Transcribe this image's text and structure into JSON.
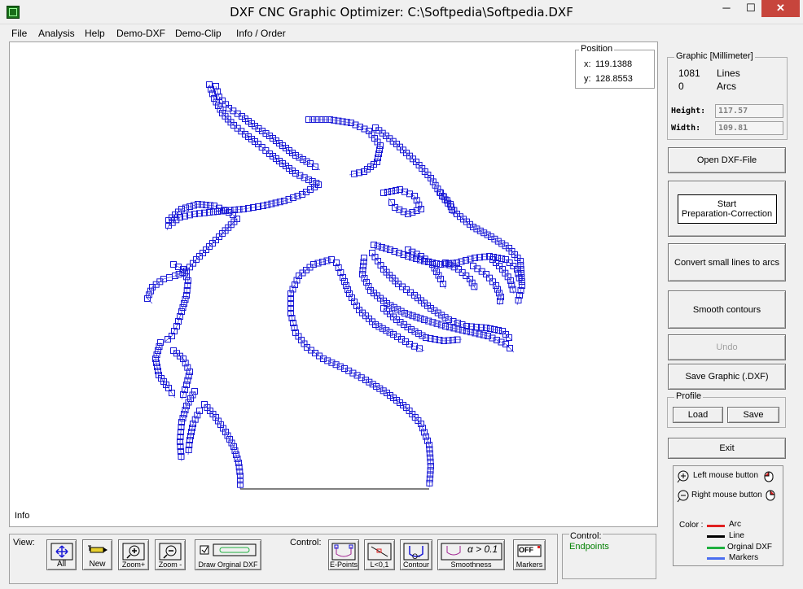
{
  "window": {
    "title": "DXF CNC Graphic Optimizer: C:\\Softpedia\\Softpedia.DXF",
    "min": "─",
    "max": "☐",
    "close": "✕"
  },
  "menu": [
    "File",
    "Analysis",
    "Help",
    "Demo-DXF",
    "Demo-Clip",
    "Info / Order"
  ],
  "position": {
    "title": "Position",
    "x_label": "x:",
    "x_value": "119.1388",
    "y_label": "y:",
    "y_value": "128.8553"
  },
  "info_label": "Info",
  "view": {
    "label": "View:",
    "buttons": [
      {
        "id": "all",
        "caption": "All"
      },
      {
        "id": "new",
        "caption": "New"
      },
      {
        "id": "zoom-in",
        "caption": "Zoom+"
      },
      {
        "id": "zoom-out",
        "caption": "Zoom -"
      },
      {
        "id": "draw-original",
        "caption": "Draw Orginal DXF"
      }
    ]
  },
  "control": {
    "label": "Control:",
    "buttons": [
      {
        "id": "e-points",
        "caption": "E-Points"
      },
      {
        "id": "l-threshold",
        "caption": "L<0,1"
      },
      {
        "id": "o-contour",
        "caption": "O-Contour"
      },
      {
        "id": "smoothness",
        "caption": "Smoothness",
        "badge": "α > 0.1"
      },
      {
        "id": "markers",
        "caption": "Markers",
        "badge": "OFF"
      }
    ],
    "status_label": "Control:",
    "status_value": "Endpoints"
  },
  "graphic": {
    "title": "Graphic [Millimeter]",
    "lines_count": "1081",
    "lines_label": "Lines",
    "arcs_count": "0",
    "arcs_label": "Arcs",
    "height_label": "Height:",
    "height_value": "117.57",
    "width_label": "Width:",
    "width_value": "109.81"
  },
  "actions": {
    "open": "Open DXF-File",
    "start_line1": "Start",
    "start_line2": "Preparation-Correction",
    "convert": "Convert small lines to arcs",
    "smooth": "Smooth contours",
    "undo": "Undo",
    "save": "Save Graphic (.DXF)",
    "exit": "Exit"
  },
  "profile": {
    "title": "Profile",
    "load": "Load",
    "save": "Save"
  },
  "legend": {
    "left_mouse": "Left mouse button",
    "right_mouse": "Right mouse button",
    "color_label": "Color :",
    "items": [
      {
        "label": "Arc",
        "color": "#e02020"
      },
      {
        "label": "Line",
        "color": "#000000"
      },
      {
        "label": "Orginal DXF",
        "color": "#20b040"
      },
      {
        "label": "Markers",
        "color": "#4a6ef0"
      }
    ]
  },
  "colors": {
    "marker": "#1a1ad6",
    "disabled_text": "#a0a0a0",
    "status_green": "#008000"
  }
}
